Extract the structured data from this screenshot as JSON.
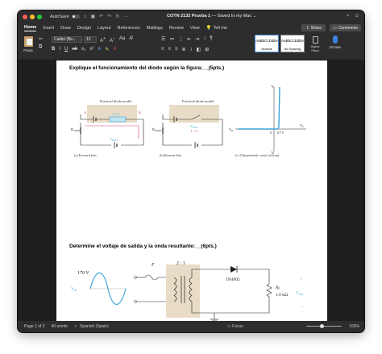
{
  "titlebar": {
    "autosave_label": "AutoSave",
    "autosave_state": "off",
    "doc_name": "COTN 2132 Prueba 1",
    "doc_status": " — Saved to my Mac ⌄"
  },
  "menu": [
    "Home",
    "Insert",
    "Draw",
    "Design",
    "Layout",
    "References",
    "Mailings",
    "Review",
    "View"
  ],
  "menu_active": "Home",
  "tell_me": "Tell me",
  "share_label": "Share",
  "comments_label": "Comments",
  "ribbon": {
    "paste_label": "Paste",
    "font_name": "Calibri (Bo...",
    "font_size": "12",
    "styles": [
      {
        "preview": "AaBbCcDdEe",
        "name": "Normal"
      },
      {
        "preview": "AaBbCcDdEe",
        "name": "No Spacing"
      }
    ],
    "styles_pane_label": "Styles Pane",
    "dictate_label": "Dictate"
  },
  "document": {
    "question1": "Explique el funcionamiento del diodo según la figura:__(5pts.)",
    "question2": "Determine el voltaje de salida y la onda resultante:__(6pts.)",
    "fig1": {
      "model_label_a": "Practical diode model",
      "model_label_b": "Practical diode model",
      "v_on_a": "0.7 V",
      "rlimit_a": "R",
      "rlimit_sub": "LIMIT",
      "vbias_a": "V",
      "vbias_sub": "BIAS",
      "caption_a": "(a) Forward bias",
      "caption_b": "(b) Reverse bias",
      "caption_c": "(c) Characteristic curve (silicon)",
      "i_equals_0": "I = 0",
      "axis_if": "I",
      "axis_if_sub": "F",
      "axis_ir": "I",
      "axis_ir_sub": "R",
      "axis_vr": "V",
      "axis_vr_sub": "R",
      "axis_vf": "V",
      "axis_vf_sub": "F",
      "knee_label": "0.7 V",
      "zero_label": "0",
      "anode": "A",
      "cathode": "K"
    },
    "fig2": {
      "source_amp": "170 V",
      "vin": "V",
      "vin_sub": "in",
      "fuse": "F",
      "ratio": "2 : 1",
      "diode": "1N4002",
      "rl": "R",
      "rl_sub": "L",
      "rl_value": "1.0 kΩ",
      "vout": "V",
      "vout_sub": "out",
      "plus": "+",
      "minus": "−"
    }
  },
  "status": {
    "page": "Page 1 of 2",
    "words": "40 words",
    "language": "Spanish (Spain)",
    "focus": "Focus",
    "zoom": "160%"
  },
  "colors": {
    "chrome": "#2d2d2d",
    "canvas": "#1e1e1e",
    "accent_blue": "#3fa6d8",
    "tan": "#e8dcc6",
    "magenta": "#d63d78"
  }
}
